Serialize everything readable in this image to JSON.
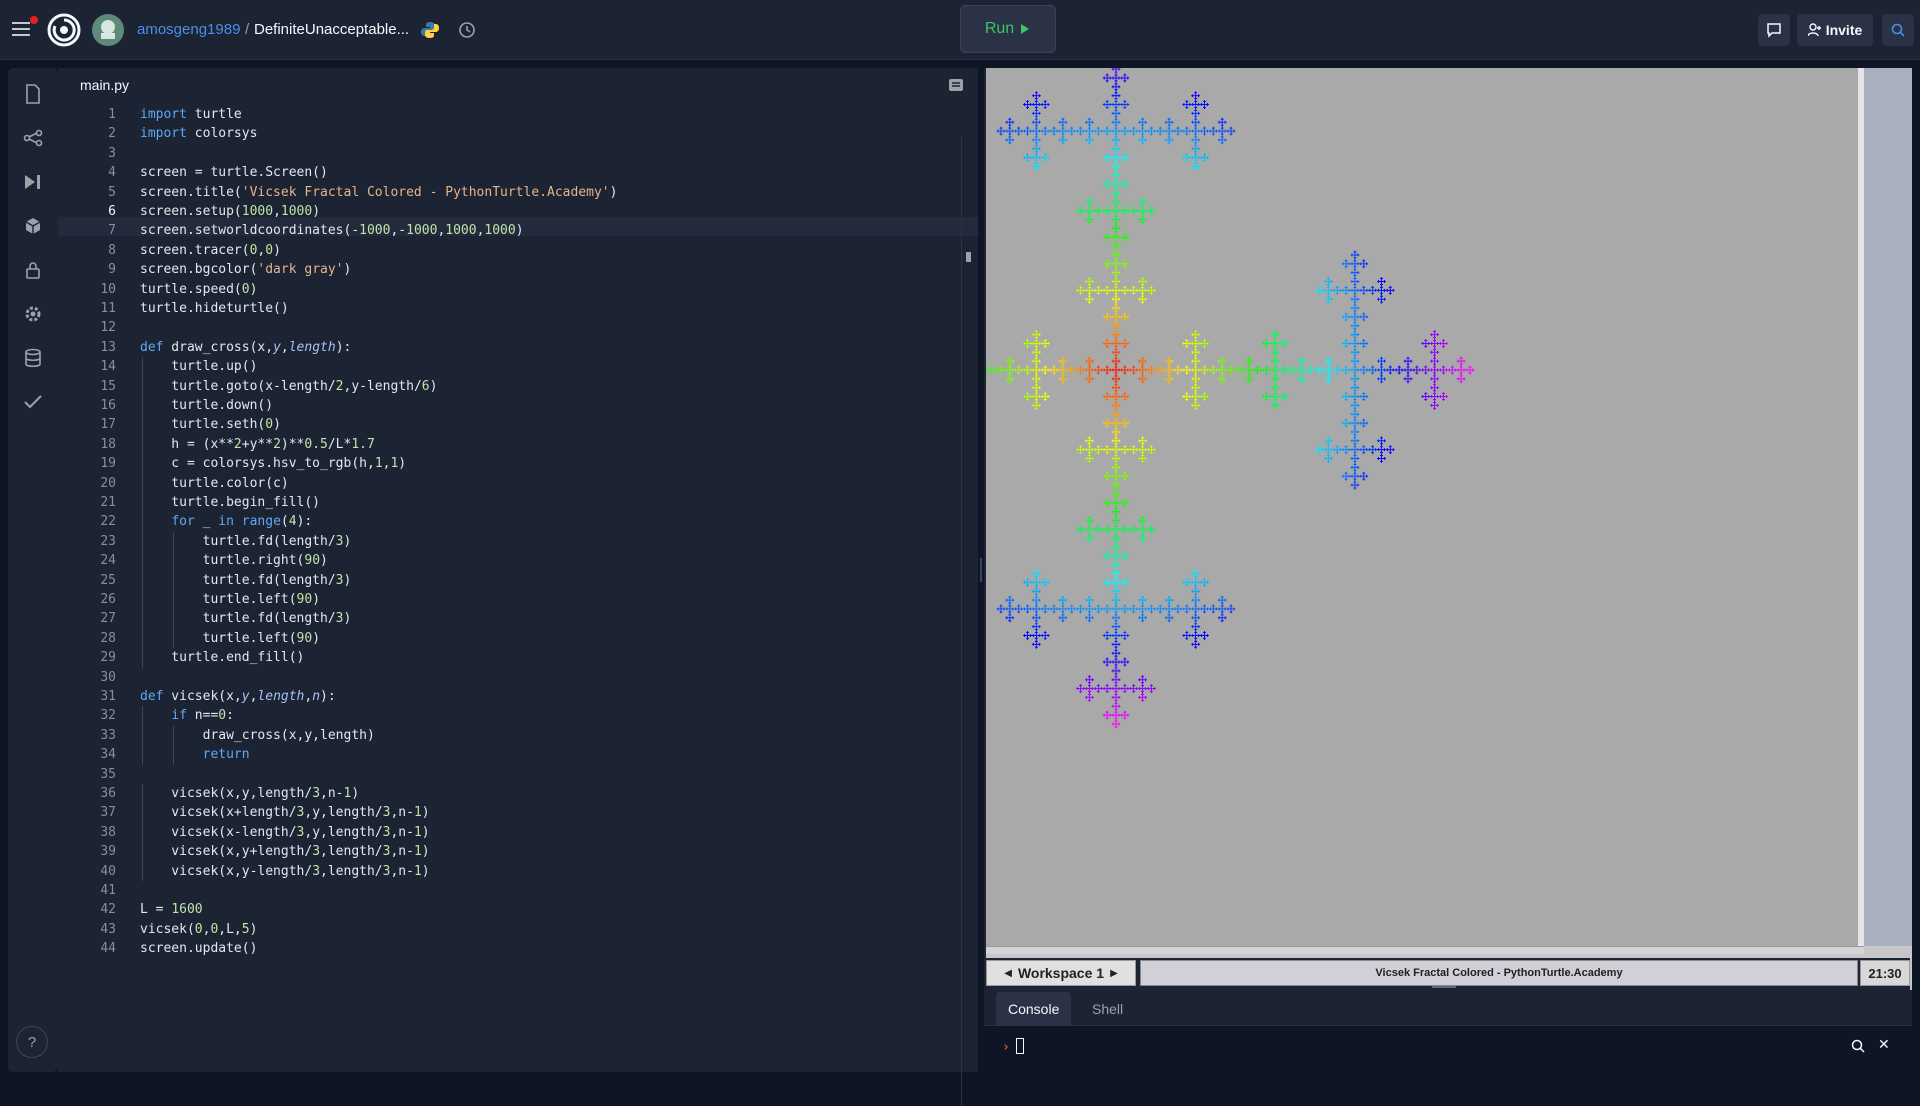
{
  "topbar": {
    "owner": "amosgeng1989",
    "separator": "/",
    "repl_name": "DefiniteUnacceptable...",
    "run_label": "Run",
    "invite_label": "Invite"
  },
  "editor": {
    "tab_name": "main.py",
    "lines": [
      "import turtle",
      "import colorsys",
      "",
      "screen = turtle.Screen()",
      "screen.title('Vicsek Fractal Colored - PythonTurtle.Academy')",
      "screen.setup(1000,1000)",
      "screen.setworldcoordinates(-1000,-1000,1000,1000)",
      "screen.tracer(0,0)",
      "screen.bgcolor('dark gray')",
      "turtle.speed(0)",
      "turtle.hideturtle()",
      "",
      "def draw_cross(x,y,length):",
      "    turtle.up()",
      "    turtle.goto(x-length/2,y-length/6)",
      "    turtle.down()",
      "    turtle.seth(0)",
      "    h = (x**2+y**2)**0.5/L*1.7",
      "    c = colorsys.hsv_to_rgb(h,1,1)",
      "    turtle.color(c)",
      "    turtle.begin_fill()",
      "    for _ in range(4):",
      "        turtle.fd(length/3)",
      "        turtle.right(90)",
      "        turtle.fd(length/3)",
      "        turtle.left(90)",
      "        turtle.fd(length/3)",
      "        turtle.left(90)",
      "    turtle.end_fill()",
      "",
      "def vicsek(x,y,length,n):",
      "    if n==0:",
      "        draw_cross(x,y,length)",
      "        return",
      "",
      "    vicsek(x,y,length/3,n-1)",
      "    vicsek(x+length/3,y,length/3,n-1)",
      "    vicsek(x-length/3,y,length/3,n-1)",
      "    vicsek(x,y+length/3,length/3,n-1)",
      "    vicsek(x,y-length/3,length/3,n-1)",
      "",
      "L = 1600",
      "vicsek(0,0,L,5)",
      "screen.update()"
    ],
    "current_line": 6
  },
  "output": {
    "workspace_label": "Workspace 1",
    "window_title": "Vicsek Fractal Colored - PythonTurtle.Academy",
    "clock": "21:30",
    "console_tab": "Console",
    "shell_tab": "Shell",
    "prompt": "›",
    "canvas_bg": "#a9a9a9"
  },
  "fractal": {
    "L": 1600,
    "depth": 5
  }
}
